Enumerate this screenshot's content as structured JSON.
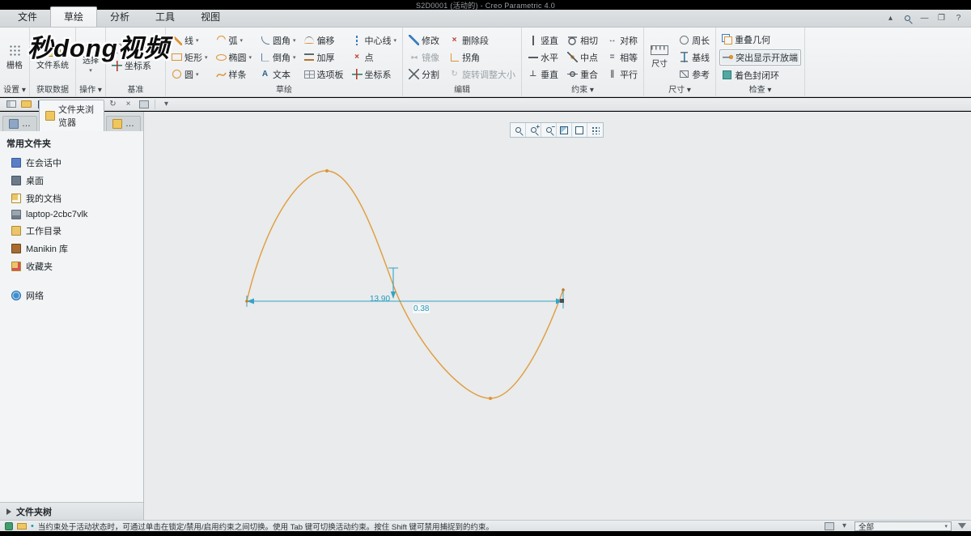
{
  "window": {
    "title": "S2D0001 (活动的) - Creo Parametric 4.0"
  },
  "watermark": "秒dong视频",
  "tabs": [
    "文件",
    "草绘",
    "分析",
    "工具",
    "视图"
  ],
  "ribbon": {
    "settings": {
      "label": "设置 ▾",
      "grid": "栅格"
    },
    "getdata": {
      "label": "获取数据",
      "filesystem": "文件系统"
    },
    "operations": {
      "label": "操作 ▾",
      "select": "选择"
    },
    "datum": {
      "label": "基准",
      "construction": "构造模式",
      "csys": "坐标系"
    },
    "sketch": {
      "label": "草绘",
      "items": [
        "线",
        "弧",
        "圆角",
        "偏移",
        "中心线",
        "矩形",
        "椭圆",
        "倒角",
        "加厚",
        "点",
        "圆",
        "样条",
        "文本",
        "选项板",
        "坐标系"
      ]
    },
    "edit": {
      "label": "编辑",
      "items": [
        "修改",
        "删除段",
        "镜像",
        "拐角",
        "分割",
        "旋转调整大小"
      ]
    },
    "constrain": {
      "label": "约束 ▾",
      "items": [
        "竖直",
        "相切",
        "对称",
        "水平",
        "中点",
        "相等",
        "垂直",
        "重合",
        "平行"
      ]
    },
    "dimension": {
      "label": "尺寸 ▾",
      "main": "尺寸",
      "items": [
        "周长",
        "基线",
        "参考"
      ]
    },
    "inspect": {
      "label": "检查 ▾",
      "items": [
        "重叠几何",
        "突出显示开放端",
        "着色封闭环"
      ]
    }
  },
  "sidebar": {
    "tab": "文件夹浏览器",
    "section": "常用文件夹",
    "items": [
      "在会话中",
      "桌面",
      "我的文档",
      "laptop-2cbc7vlk",
      "工作目录",
      "Manikin 库",
      "收藏夹",
      "网络"
    ],
    "footer": "文件夹树"
  },
  "canvas": {
    "dim_width": "13.90",
    "dim_height": "0.38"
  },
  "statusbar": {
    "message": "当约束处于活动状态时，可通过单击在锁定/禁用/启用约束之间切换。使用 Tab 键可切换活动约束。按住 Shift 键可禁用捕捉到的约束。",
    "filter": "全部"
  }
}
